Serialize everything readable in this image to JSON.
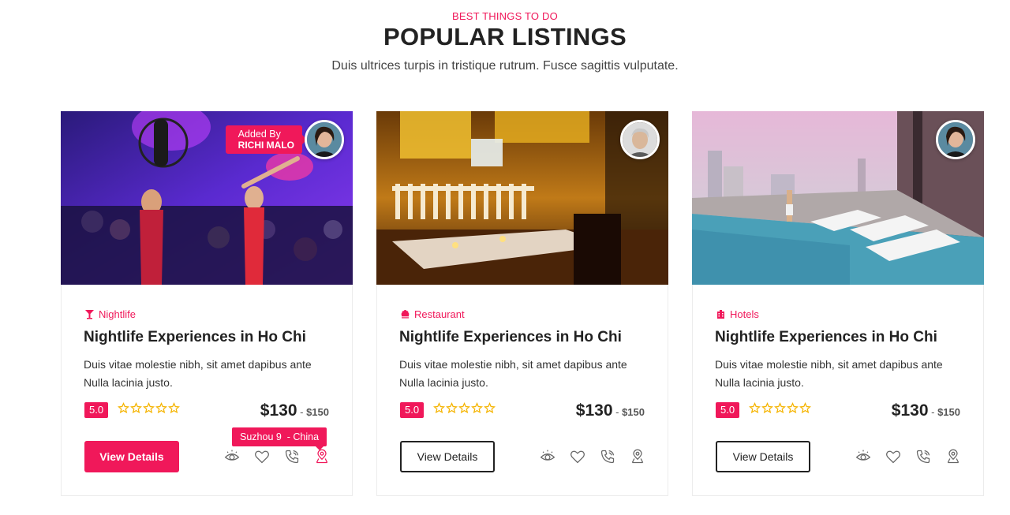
{
  "section": {
    "eyebrow": "BEST THINGS TO DO",
    "title": "POPULAR LISTINGS",
    "subtitle": "Duis ultrices turpis in tristique rutrum. Fusce sagittis vulputate."
  },
  "colors": {
    "accent": "#f0185a",
    "text": "#222222",
    "star": "#f5b400"
  },
  "listings": [
    {
      "added_by_label": "Added By",
      "added_by_name": "RICHI MALO",
      "category": "Nightlife",
      "category_icon": "cocktail-icon",
      "title": "Nightlife Experiences in Ho Chi",
      "description": "Duis vitae molestie nibh, sit amet dapibus ante Nulla lacinia justo.",
      "rating": "5.0",
      "stars": 5,
      "price": "$130",
      "price_sep": " - ",
      "price_max": "$150",
      "button": "View Details",
      "location_tooltip": "Suzhou 9  - China"
    },
    {
      "category": "Restaurant",
      "category_icon": "chef-hat-icon",
      "title": "Nightlife Experiences in Ho Chi",
      "description": "Duis vitae molestie nibh, sit amet dapibus ante Nulla lacinia justo.",
      "rating": "5.0",
      "stars": 5,
      "price": "$130",
      "price_sep": " - ",
      "price_max": "$150",
      "button": "View Details"
    },
    {
      "category": "Hotels",
      "category_icon": "hotel-icon",
      "title": "Nightlife Experiences in Ho Chi",
      "description": "Duis vitae molestie nibh, sit amet dapibus ante Nulla lacinia justo.",
      "rating": "5.0",
      "stars": 5,
      "price": "$130",
      "price_sep": " - ",
      "price_max": "$150",
      "button": "View Details"
    }
  ]
}
